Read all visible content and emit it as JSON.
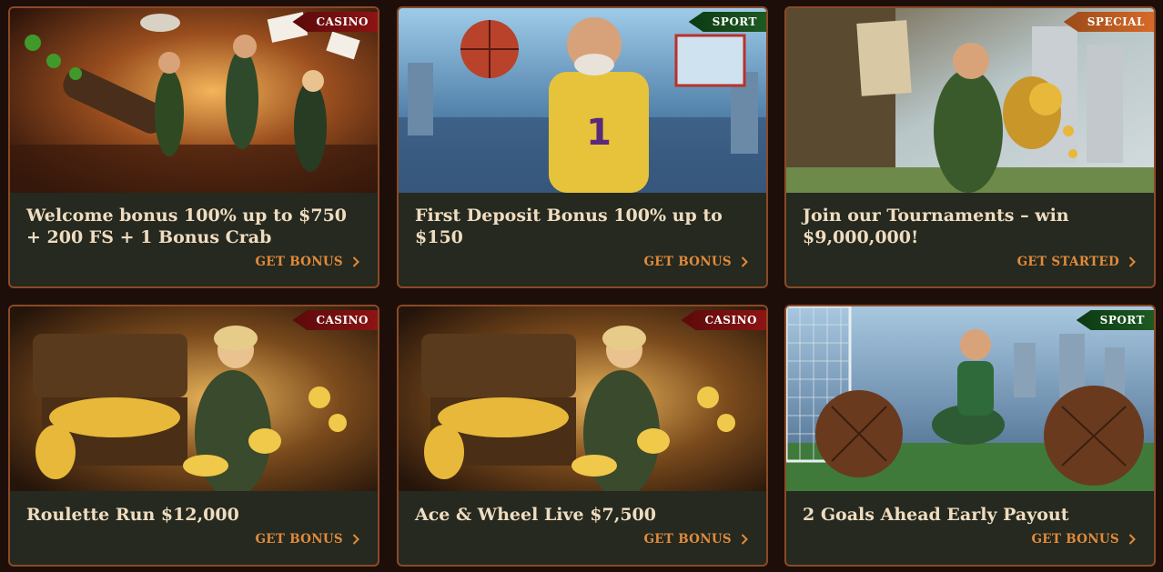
{
  "promos": [
    {
      "tag": "CASINO",
      "title": "Welcome bonus 100% up to $750 + 200 FS + 1 Bonus Crab",
      "cta": "GET BONUS",
      "image": "archers-with-cannon-tavern"
    },
    {
      "tag": "SPORT",
      "title": "First Deposit Bonus 100% up to $150",
      "cta": "GET BONUS",
      "image": "basketball-player-stadium"
    },
    {
      "tag": "SPECIAL",
      "title": "Join our Tournaments – win $9,000,000!",
      "cta": "GET STARTED",
      "image": "archer-with-trophy-castle"
    },
    {
      "tag": "CASINO",
      "title": "Roulette Run $12,000",
      "cta": "GET BONUS",
      "image": "archer-woman-treasure-chest"
    },
    {
      "tag": "CASINO",
      "title": "Ace & Wheel Live $7,500",
      "cta": "GET BONUS",
      "image": "archer-woman-treasure-chest"
    },
    {
      "tag": "SPORT",
      "title": "2 Goals Ahead Early Payout",
      "cta": "GET BONUS",
      "image": "football-player-with-balls"
    }
  ],
  "colors": {
    "page_bg": "#1e0e09",
    "card_bg": "#25291f",
    "card_border": "#8a4a26",
    "title": "#efdcc0",
    "cta": "#e08a3c",
    "tag_casino": "#8e1414",
    "tag_sport": "#1e5a22",
    "tag_special": "#d86a28"
  },
  "icons": {
    "cta_arrow": "chevron-right-icon"
  }
}
